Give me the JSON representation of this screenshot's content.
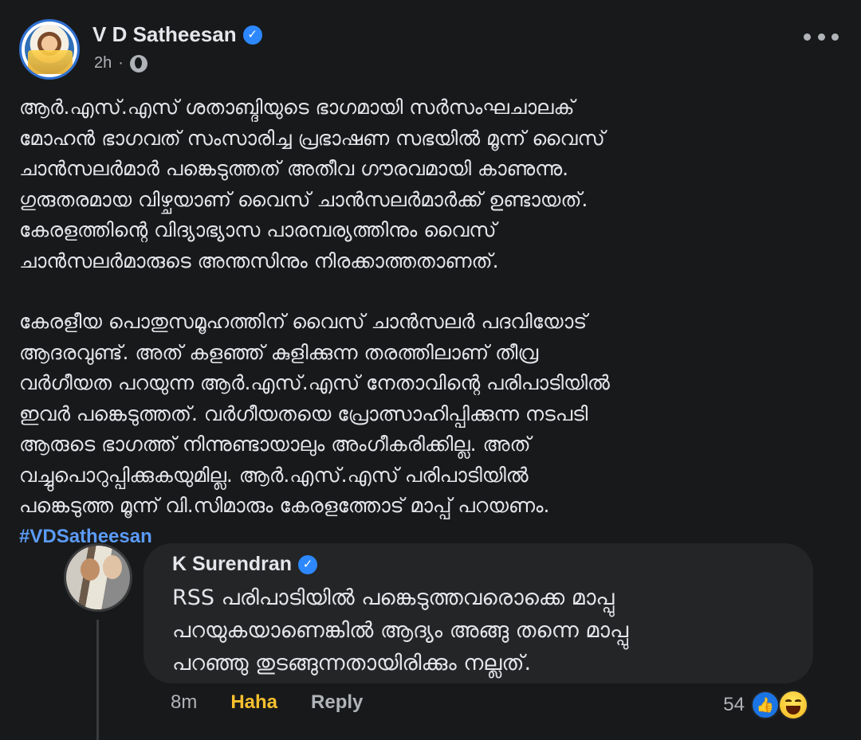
{
  "post": {
    "author": "V D Satheesan",
    "author_verified_icon": "verified-badge-icon",
    "time": "2h",
    "audience_icon": "globe-icon",
    "separator": "·",
    "paragraph1": [
      "ആർ.എസ്.എസ് ശതാബ്ദിയുടെ ഭാഗമായി സർസംഘചാലക്",
      "മോഹൻ ഭാഗവത് സംസാരിച്ച പ്രഭാഷണ സഭയിൽ മൂന്ന് വൈസ്",
      "ചാൻസലർമാർ പങ്കെടുത്തത് അതീവ ഗൗരവമായി കാണുന്നു.",
      "ഗുരുതരമായ വിഴ്ചയാണ് വൈസ് ചാൻസലർമാർക്ക് ഉണ്ടായത്.",
      "കേരളത്തിന്റെ വിദ്യാഭ്യാസ പാരമ്പര്യത്തിനും വൈസ്",
      "ചാൻസലർമാരുടെ അന്തസിനും നിരക്കാത്തതാണത്."
    ],
    "paragraph2": [
      "കേരളീയ പൊതുസമൂഹത്തിന് വൈസ് ചാൻസലർ പദവിയോട്",
      "ആദരവുണ്ട്. അത് കളഞ്ഞ് കുളിക്കുന്ന തരത്തിലാണ് തീവ്ര",
      "വർഗീയത പറയുന്ന ആർ.എസ്.എസ് നേതാവിന്റെ പരിപാടിയിൽ",
      "ഇവർ പങ്കെടുത്തത്. വർഗീയതയെ പ്രോത്സാഹിപ്പിക്കുന്ന നടപടി",
      "ആരുടെ ഭാഗത്ത് നിന്നുണ്ടായാലും അംഗീകരിക്കില്ല. അത്",
      "വച്ചുപൊറുപ്പിക്കുകയുമില്ല. ആർ.എസ്.എസ് പരിപാടിയിൽ",
      "പങ്കെടുത്ത മൂന്ന് വി.സിമാരും കേരളത്തോട് മാപ്പ് പറയണം."
    ],
    "hashtag": "#VDSatheesan"
  },
  "comment": {
    "author": "K Surendran",
    "text": [
      "RSS പരിപാടിയിൽ പങ്കെടുത്തവരൊക്കെ മാപ്പു",
      "പറയുകയാണെങ്കിൽ ആദ്യം അങ്ങു തന്നെ മാപ്പു",
      "പറഞ്ഞു തുടങ്ങുന്നതായിരിക്കും നല്ലത്."
    ],
    "time": "8m",
    "reaction_action": "Haha",
    "reply_label": "Reply",
    "reaction_count": "54",
    "reaction_icons": [
      "like-icon",
      "haha-icon"
    ]
  },
  "colors": {
    "background": "#18191a",
    "bubble": "#242526",
    "hashtag": "#5b9bf6",
    "verified": "#2d88ff",
    "haha_text": "#f7c02e"
  }
}
